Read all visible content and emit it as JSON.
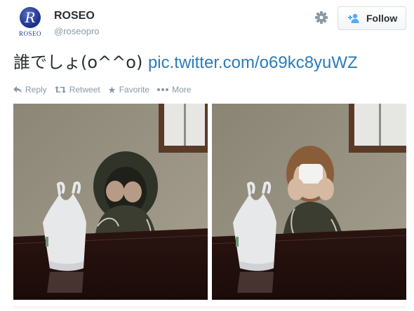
{
  "user": {
    "name": "ROSEO",
    "handle": "@roseopro",
    "avatar_icon": "roseo-logo-icon",
    "avatar_logo_text": "ROSEO",
    "avatar_logo_letter": "R"
  },
  "actions_top": {
    "settings_icon": "gear-icon",
    "follow_label": "Follow",
    "follow_icon": "add-user-icon"
  },
  "tweet": {
    "text": "誰でしょ(o^^o) ",
    "link": "pic.twitter.com/o69kc8yuWZ",
    "link_color": "#2b7bb9"
  },
  "tweet_actions": [
    {
      "label": "Reply",
      "icon": "reply-icon"
    },
    {
      "label": "Retweet",
      "icon": "retweet-icon"
    },
    {
      "label": "Favorite",
      "icon": "star-icon"
    },
    {
      "label": "More",
      "icon": "more-dots-icon"
    }
  ],
  "photos": [
    {
      "icon": "photo-hooded-person-with-bag"
    },
    {
      "icon": "photo-masked-person-with-bag"
    }
  ]
}
